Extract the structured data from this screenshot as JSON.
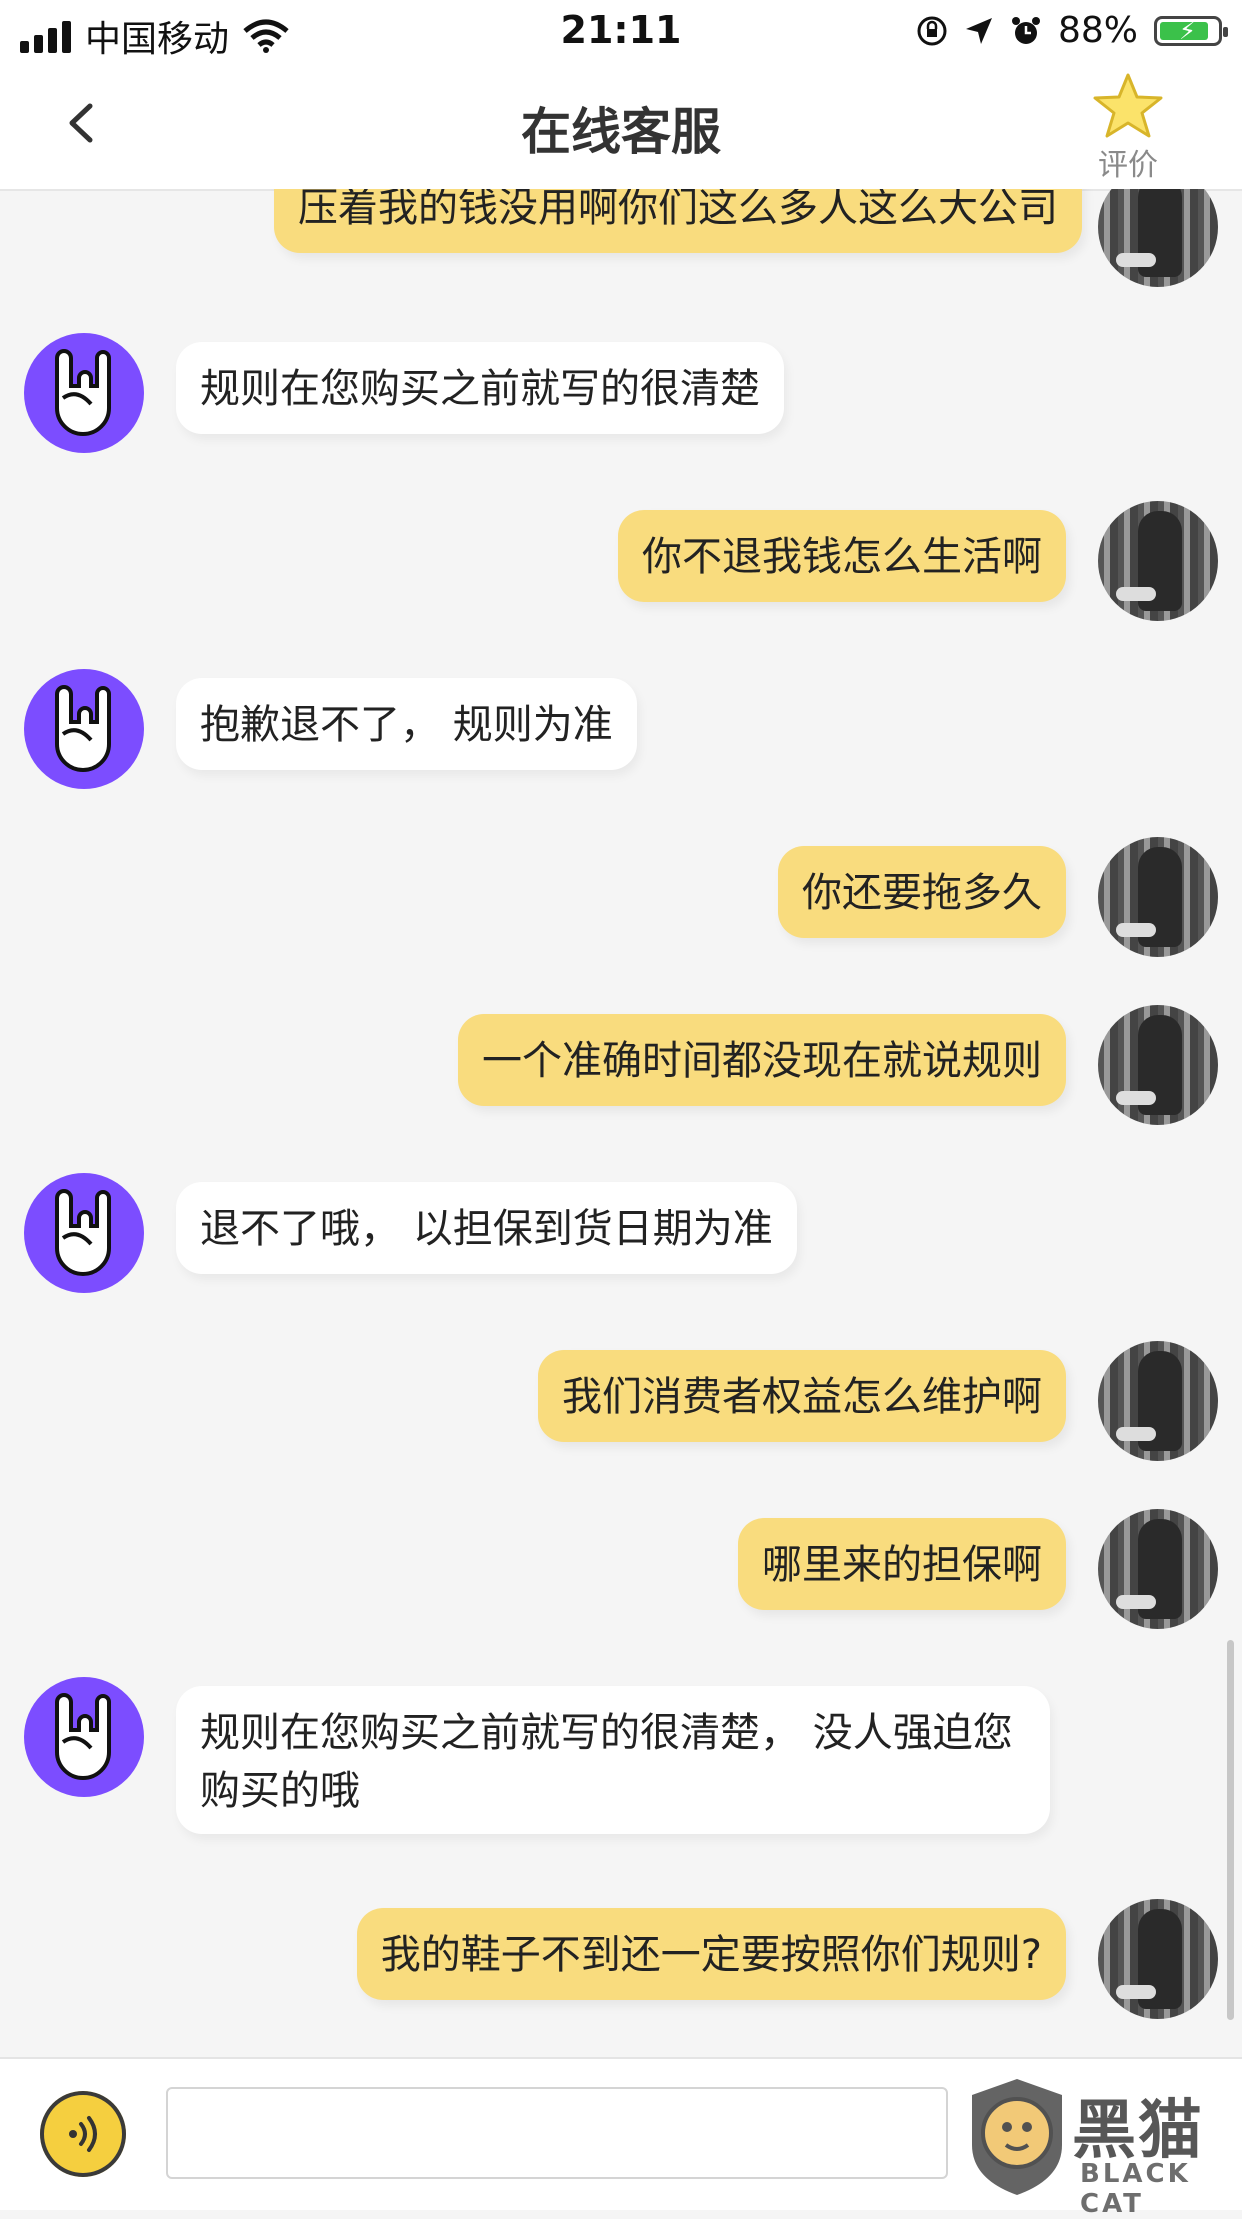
{
  "status_bar": {
    "carrier": "中国移动",
    "time": "21:11",
    "battery": "88%"
  },
  "header": {
    "title": "在线客服",
    "rate_label": "评价"
  },
  "messages": [
    {
      "side": "right",
      "text": "压着我的钱没用啊你们这么多人这么大公司"
    },
    {
      "side": "left",
      "text": "规则在您购买之前就写的很清楚"
    },
    {
      "side": "right",
      "text": "你不退我钱怎么生活啊"
    },
    {
      "side": "left",
      "text": "抱歉退不了， 规则为准"
    },
    {
      "side": "right",
      "text": "你还要拖多久"
    },
    {
      "side": "right",
      "text": "一个准确时间都没现在就说规则"
    },
    {
      "side": "left",
      "text": "退不了哦， 以担保到货日期为准"
    },
    {
      "side": "right",
      "text": "我们消费者权益怎么维护啊"
    },
    {
      "side": "right",
      "text": "哪里来的担保啊"
    },
    {
      "side": "left",
      "text": "规则在您购买之前就写的很清楚， 没人强迫您购买的哦"
    },
    {
      "side": "right",
      "text": "我的鞋子不到还一定要按照你们规则?"
    }
  ],
  "input": {
    "value": "",
    "placeholder": ""
  },
  "watermark": {
    "brand": "黑猫",
    "sub": "BLACK CAT"
  },
  "colors": {
    "user_bubble": "#f9dc7e",
    "agent_bubble": "#ffffff",
    "bot_avatar": "#7c4dff",
    "voice_button": "#f5cf3f"
  },
  "icons": {
    "back": "chevron-left-icon",
    "rate": "star-icon",
    "voice": "voice-icon"
  }
}
